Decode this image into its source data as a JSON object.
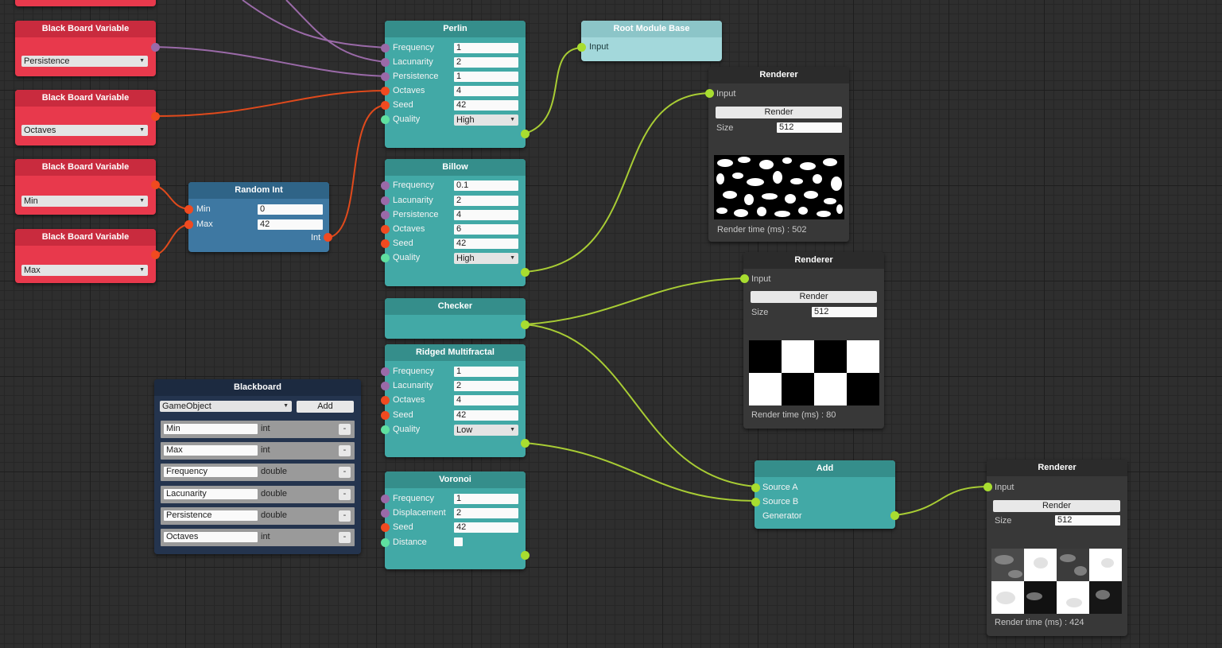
{
  "colors": {
    "teal": "#42a9a6",
    "red": "#e8394c",
    "blue": "#3e78a2",
    "wire_green": "#a8cc34",
    "wire_purple": "#9a6aa8",
    "wire_orange": "#e04a1c"
  },
  "bbv": [
    {
      "title": "Black Board Variable",
      "value": ""
    },
    {
      "title": "Black Board Variable",
      "value": "Persistence"
    },
    {
      "title": "Black Board Variable",
      "value": "Octaves"
    },
    {
      "title": "Black Board Variable",
      "value": "Min"
    },
    {
      "title": "Black Board Variable",
      "value": "Max"
    }
  ],
  "random_int": {
    "title": "Random Int",
    "min_label": "Min",
    "min": "0",
    "max_label": "Max",
    "max": "42",
    "out_label": "Int"
  },
  "perlin": {
    "title": "Perlin",
    "rows": [
      "Frequency",
      "Lacunarity",
      "Persistence",
      "Octaves",
      "Seed",
      "Quality"
    ],
    "values": [
      "1",
      "2",
      "1",
      "4",
      "42",
      "High"
    ]
  },
  "billow": {
    "title": "Billow",
    "rows": [
      "Frequency",
      "Lacunarity",
      "Persistence",
      "Octaves",
      "Seed",
      "Quality"
    ],
    "values": [
      "0.1",
      "2",
      "4",
      "6",
      "42",
      "High"
    ]
  },
  "checker": {
    "title": "Checker"
  },
  "ridged": {
    "title": "Ridged Multifractal",
    "rows": [
      "Frequency",
      "Lacunarity",
      "Octaves",
      "Seed",
      "Quality"
    ],
    "values": [
      "1",
      "2",
      "4",
      "42",
      "Low"
    ]
  },
  "voronoi": {
    "title": "Voronoi",
    "rows": [
      "Frequency",
      "Displacement",
      "Seed",
      "Distance"
    ],
    "values": [
      "1",
      "2",
      "42"
    ]
  },
  "root": {
    "title": "Root Module Base",
    "input": "Input"
  },
  "add": {
    "title": "Add",
    "rows": [
      "Source A",
      "Source B",
      "Generator"
    ]
  },
  "renderers": [
    {
      "title": "Renderer",
      "input": "Input",
      "button": "Render",
      "size_label": "Size",
      "size": "512",
      "time": "Render time (ms) : 502"
    },
    {
      "title": "Renderer",
      "input": "Input",
      "button": "Render",
      "size_label": "Size",
      "size": "512",
      "time": "Render time (ms) : 80"
    },
    {
      "title": "Renderer",
      "input": "Input",
      "button": "Render",
      "size_label": "Size",
      "size": "512",
      "time": "Render time (ms) : 424"
    }
  ],
  "blackboard": {
    "title": "Blackboard",
    "type_select": "GameObject",
    "add_label": "Add",
    "vars": [
      {
        "name": "Min",
        "type": "int"
      },
      {
        "name": "Max",
        "type": "int"
      },
      {
        "name": "Frequency",
        "type": "double"
      },
      {
        "name": "Lacunarity",
        "type": "double"
      },
      {
        "name": "Persistence",
        "type": "double"
      },
      {
        "name": "Octaves",
        "type": "int"
      }
    ],
    "remove_label": "-"
  }
}
